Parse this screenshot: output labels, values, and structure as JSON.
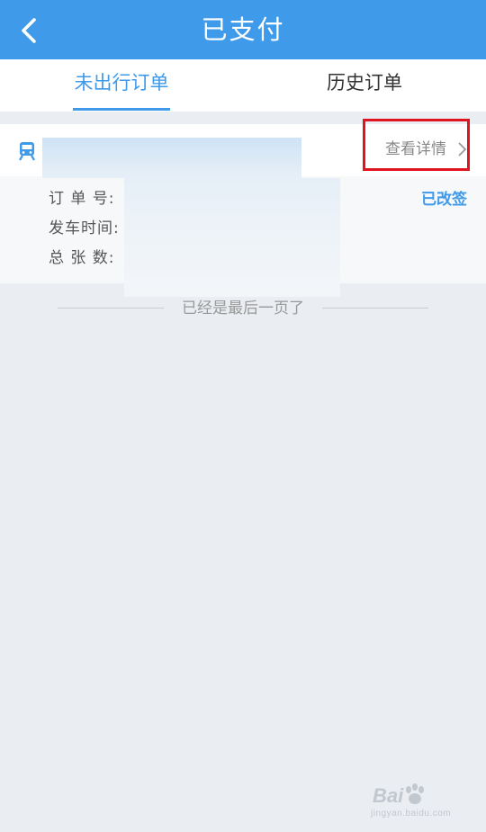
{
  "header": {
    "title": "已支付",
    "back_icon": "chevron-left-icon",
    "background_color": "#3f9ae9"
  },
  "tabs": [
    {
      "label": "未出行订单",
      "active": true
    },
    {
      "label": "历史订单",
      "active": false
    }
  ],
  "order_card": {
    "type_icon": "train-icon",
    "detail_link_label": "查看详情",
    "status": "已改签",
    "fields": [
      {
        "label": "订 单 号:"
      },
      {
        "label": "发车时间:"
      },
      {
        "label": "总 张 数:"
      }
    ]
  },
  "list_end_text": "已经是最后一页了",
  "watermark": {
    "brand": "Bai",
    "sub": "jingyan.baidu.com"
  },
  "colors": {
    "accent": "#3f9ae9",
    "highlight_border": "#e0141e",
    "page_background": "#eaedf1"
  }
}
